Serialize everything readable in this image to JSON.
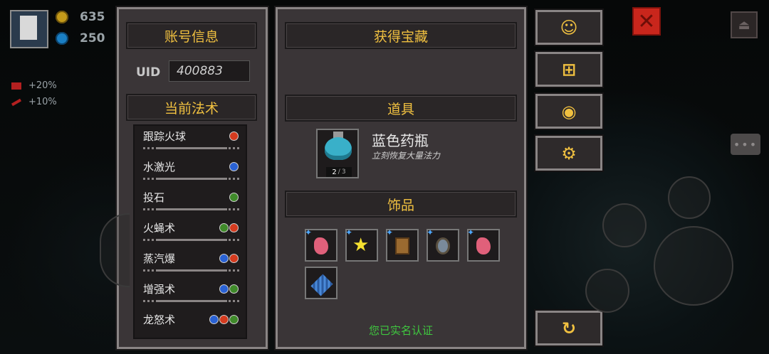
{
  "hud": {
    "gold": "635",
    "gems": "250",
    "buffs": [
      {
        "icon": "heart-icon",
        "text": "+20%"
      },
      {
        "icon": "sword-icon",
        "text": "+10%"
      }
    ]
  },
  "account": {
    "title": "账号信息",
    "uid_label": "UID",
    "uid_value": "400883",
    "spells_title": "当前法术",
    "spells": [
      {
        "name": "跟踪火球",
        "elements": [
          "fire"
        ]
      },
      {
        "name": "水激光",
        "elements": [
          "water"
        ]
      },
      {
        "name": "投石",
        "elements": [
          "earth"
        ]
      },
      {
        "name": "火蝇术",
        "elements": [
          "earth",
          "fire"
        ]
      },
      {
        "name": "蒸汽爆",
        "elements": [
          "water",
          "fire"
        ]
      },
      {
        "name": "增强术",
        "elements": [
          "water",
          "earth"
        ]
      },
      {
        "name": "龙怒术",
        "elements": [
          "water",
          "fire",
          "earth"
        ]
      }
    ]
  },
  "treasure": {
    "title": "获得宝藏",
    "props_title": "道具",
    "item": {
      "name": "蓝色药瓶",
      "desc": "立刻恢复大量法力",
      "count": "2",
      "max": "3"
    },
    "accessories_title": "饰品",
    "accessories": [
      {
        "icon": "pink-crystal-icon",
        "color": "#e0607a"
      },
      {
        "icon": "star-icon",
        "color": "#f5e030"
      },
      {
        "icon": "scroll-icon",
        "color": "#9a6a30"
      },
      {
        "icon": "necklace-icon",
        "color": "#7a8a9a"
      },
      {
        "icon": "pink-crystal-icon",
        "color": "#e0607a"
      },
      {
        "icon": "blue-net-icon",
        "color": "#4a8ad8"
      }
    ],
    "realname_text": "您已实名认证"
  },
  "side_buttons": [
    {
      "name": "support-button",
      "icon": "headset-icon"
    },
    {
      "name": "gift-button",
      "icon": "gift-icon"
    },
    {
      "name": "code-button",
      "icon": "mask-icon"
    },
    {
      "name": "settings-button",
      "icon": "gear-icon"
    },
    {
      "name": "refresh-button",
      "icon": "refresh-icon"
    }
  ]
}
